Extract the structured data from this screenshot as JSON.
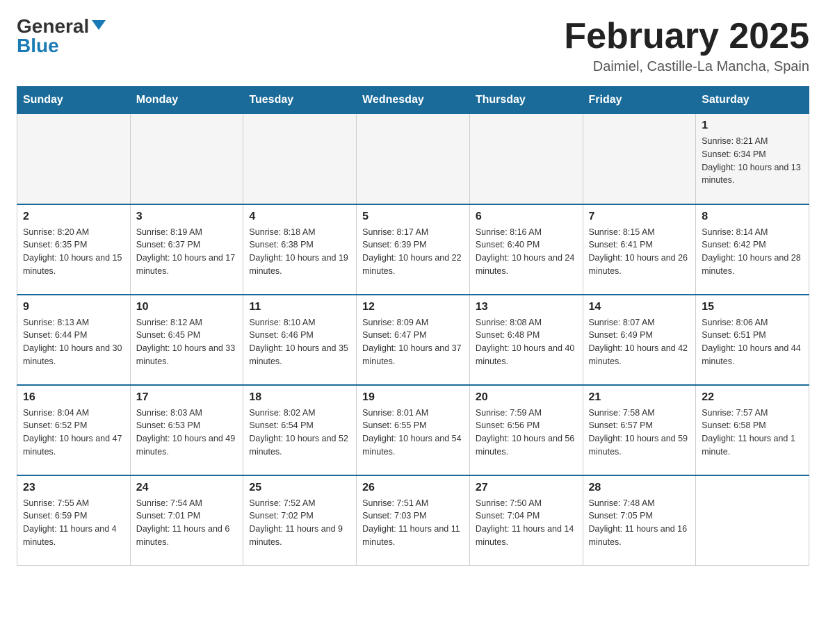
{
  "header": {
    "logo_general": "General",
    "logo_blue": "Blue",
    "title": "February 2025",
    "subtitle": "Daimiel, Castille-La Mancha, Spain"
  },
  "days_of_week": [
    "Sunday",
    "Monday",
    "Tuesday",
    "Wednesday",
    "Thursday",
    "Friday",
    "Saturday"
  ],
  "weeks": [
    [
      {
        "day": "",
        "sunrise": "",
        "sunset": "",
        "daylight": ""
      },
      {
        "day": "",
        "sunrise": "",
        "sunset": "",
        "daylight": ""
      },
      {
        "day": "",
        "sunrise": "",
        "sunset": "",
        "daylight": ""
      },
      {
        "day": "",
        "sunrise": "",
        "sunset": "",
        "daylight": ""
      },
      {
        "day": "",
        "sunrise": "",
        "sunset": "",
        "daylight": ""
      },
      {
        "day": "",
        "sunrise": "",
        "sunset": "",
        "daylight": ""
      },
      {
        "day": "1",
        "sunrise": "Sunrise: 8:21 AM",
        "sunset": "Sunset: 6:34 PM",
        "daylight": "Daylight: 10 hours and 13 minutes."
      }
    ],
    [
      {
        "day": "2",
        "sunrise": "Sunrise: 8:20 AM",
        "sunset": "Sunset: 6:35 PM",
        "daylight": "Daylight: 10 hours and 15 minutes."
      },
      {
        "day": "3",
        "sunrise": "Sunrise: 8:19 AM",
        "sunset": "Sunset: 6:37 PM",
        "daylight": "Daylight: 10 hours and 17 minutes."
      },
      {
        "day": "4",
        "sunrise": "Sunrise: 8:18 AM",
        "sunset": "Sunset: 6:38 PM",
        "daylight": "Daylight: 10 hours and 19 minutes."
      },
      {
        "day": "5",
        "sunrise": "Sunrise: 8:17 AM",
        "sunset": "Sunset: 6:39 PM",
        "daylight": "Daylight: 10 hours and 22 minutes."
      },
      {
        "day": "6",
        "sunrise": "Sunrise: 8:16 AM",
        "sunset": "Sunset: 6:40 PM",
        "daylight": "Daylight: 10 hours and 24 minutes."
      },
      {
        "day": "7",
        "sunrise": "Sunrise: 8:15 AM",
        "sunset": "Sunset: 6:41 PM",
        "daylight": "Daylight: 10 hours and 26 minutes."
      },
      {
        "day": "8",
        "sunrise": "Sunrise: 8:14 AM",
        "sunset": "Sunset: 6:42 PM",
        "daylight": "Daylight: 10 hours and 28 minutes."
      }
    ],
    [
      {
        "day": "9",
        "sunrise": "Sunrise: 8:13 AM",
        "sunset": "Sunset: 6:44 PM",
        "daylight": "Daylight: 10 hours and 30 minutes."
      },
      {
        "day": "10",
        "sunrise": "Sunrise: 8:12 AM",
        "sunset": "Sunset: 6:45 PM",
        "daylight": "Daylight: 10 hours and 33 minutes."
      },
      {
        "day": "11",
        "sunrise": "Sunrise: 8:10 AM",
        "sunset": "Sunset: 6:46 PM",
        "daylight": "Daylight: 10 hours and 35 minutes."
      },
      {
        "day": "12",
        "sunrise": "Sunrise: 8:09 AM",
        "sunset": "Sunset: 6:47 PM",
        "daylight": "Daylight: 10 hours and 37 minutes."
      },
      {
        "day": "13",
        "sunrise": "Sunrise: 8:08 AM",
        "sunset": "Sunset: 6:48 PM",
        "daylight": "Daylight: 10 hours and 40 minutes."
      },
      {
        "day": "14",
        "sunrise": "Sunrise: 8:07 AM",
        "sunset": "Sunset: 6:49 PM",
        "daylight": "Daylight: 10 hours and 42 minutes."
      },
      {
        "day": "15",
        "sunrise": "Sunrise: 8:06 AM",
        "sunset": "Sunset: 6:51 PM",
        "daylight": "Daylight: 10 hours and 44 minutes."
      }
    ],
    [
      {
        "day": "16",
        "sunrise": "Sunrise: 8:04 AM",
        "sunset": "Sunset: 6:52 PM",
        "daylight": "Daylight: 10 hours and 47 minutes."
      },
      {
        "day": "17",
        "sunrise": "Sunrise: 8:03 AM",
        "sunset": "Sunset: 6:53 PM",
        "daylight": "Daylight: 10 hours and 49 minutes."
      },
      {
        "day": "18",
        "sunrise": "Sunrise: 8:02 AM",
        "sunset": "Sunset: 6:54 PM",
        "daylight": "Daylight: 10 hours and 52 minutes."
      },
      {
        "day": "19",
        "sunrise": "Sunrise: 8:01 AM",
        "sunset": "Sunset: 6:55 PM",
        "daylight": "Daylight: 10 hours and 54 minutes."
      },
      {
        "day": "20",
        "sunrise": "Sunrise: 7:59 AM",
        "sunset": "Sunset: 6:56 PM",
        "daylight": "Daylight: 10 hours and 56 minutes."
      },
      {
        "day": "21",
        "sunrise": "Sunrise: 7:58 AM",
        "sunset": "Sunset: 6:57 PM",
        "daylight": "Daylight: 10 hours and 59 minutes."
      },
      {
        "day": "22",
        "sunrise": "Sunrise: 7:57 AM",
        "sunset": "Sunset: 6:58 PM",
        "daylight": "Daylight: 11 hours and 1 minute."
      }
    ],
    [
      {
        "day": "23",
        "sunrise": "Sunrise: 7:55 AM",
        "sunset": "Sunset: 6:59 PM",
        "daylight": "Daylight: 11 hours and 4 minutes."
      },
      {
        "day": "24",
        "sunrise": "Sunrise: 7:54 AM",
        "sunset": "Sunset: 7:01 PM",
        "daylight": "Daylight: 11 hours and 6 minutes."
      },
      {
        "day": "25",
        "sunrise": "Sunrise: 7:52 AM",
        "sunset": "Sunset: 7:02 PM",
        "daylight": "Daylight: 11 hours and 9 minutes."
      },
      {
        "day": "26",
        "sunrise": "Sunrise: 7:51 AM",
        "sunset": "Sunset: 7:03 PM",
        "daylight": "Daylight: 11 hours and 11 minutes."
      },
      {
        "day": "27",
        "sunrise": "Sunrise: 7:50 AM",
        "sunset": "Sunset: 7:04 PM",
        "daylight": "Daylight: 11 hours and 14 minutes."
      },
      {
        "day": "28",
        "sunrise": "Sunrise: 7:48 AM",
        "sunset": "Sunset: 7:05 PM",
        "daylight": "Daylight: 11 hours and 16 minutes."
      },
      {
        "day": "",
        "sunrise": "",
        "sunset": "",
        "daylight": ""
      }
    ]
  ]
}
